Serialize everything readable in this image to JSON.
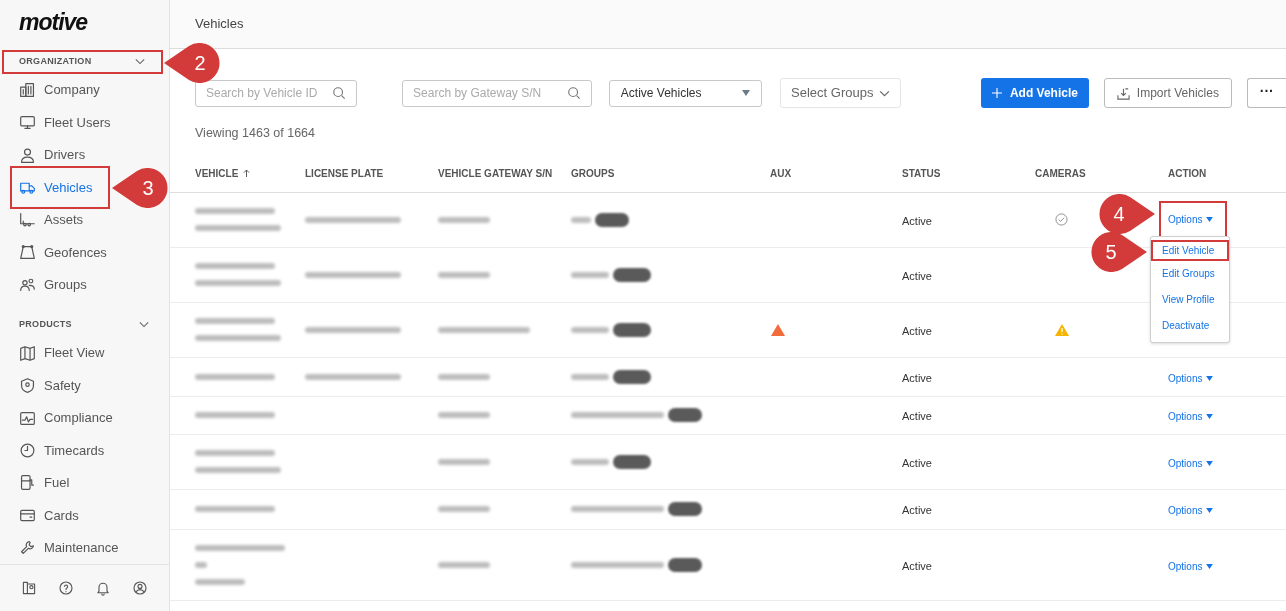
{
  "logo": "motive",
  "sidebar": {
    "sections": [
      {
        "title": "ORGANIZATION",
        "expanded": true,
        "items": [
          {
            "label": "Company",
            "selected": false
          },
          {
            "label": "Fleet Users",
            "selected": false
          },
          {
            "label": "Drivers",
            "selected": false
          },
          {
            "label": "Vehicles",
            "selected": true
          },
          {
            "label": "Assets",
            "selected": false
          },
          {
            "label": "Geofences",
            "selected": false
          },
          {
            "label": "Groups",
            "selected": false
          }
        ]
      },
      {
        "title": "PRODUCTS",
        "expanded": true,
        "items": [
          {
            "label": "Fleet View",
            "selected": false
          },
          {
            "label": "Safety",
            "selected": false
          },
          {
            "label": "Compliance",
            "selected": false
          },
          {
            "label": "Timecards",
            "selected": false
          },
          {
            "label": "Fuel",
            "selected": false
          },
          {
            "label": "Cards",
            "selected": false
          },
          {
            "label": "Maintenance",
            "selected": false
          }
        ]
      }
    ]
  },
  "page_title": "Vehicles",
  "toolbar": {
    "search_vehicle": {
      "placeholder": "Search by Vehicle ID"
    },
    "search_gateway": {
      "placeholder": "Search by Gateway S/N"
    },
    "status_select": "Active Vehicles",
    "groups_select": "Select Groups",
    "add_button": "Add Vehicle",
    "import_button": "Import Vehicles",
    "more_button": "···"
  },
  "viewing": "Viewing 1463 of 1664",
  "table": {
    "columns": [
      {
        "label": "VEHICLE",
        "sorted": true
      },
      {
        "label": "LICENSE PLATE",
        "sorted": false
      },
      {
        "label": "VEHICLE GATEWAY S/N",
        "sorted": false
      },
      {
        "label": "GROUPS",
        "sorted": false
      },
      {
        "label": "AUX",
        "sorted": false
      },
      {
        "label": "STATUS",
        "sorted": false
      },
      {
        "label": "CAMERAS",
        "sorted": false
      },
      {
        "label": "ACTION",
        "sorted": false
      }
    ],
    "rows": [
      {
        "aux_warning": false,
        "status": "Active",
        "camera_ok": true,
        "camera_warning": false,
        "action": "Options"
      },
      {
        "aux_warning": false,
        "status": "Active",
        "camera_ok": false,
        "camera_warning": false
      },
      {
        "aux_warning": true,
        "status": "Active",
        "camera_ok": false,
        "camera_warning": true
      },
      {
        "aux_warning": false,
        "status": "Active",
        "camera_ok": false,
        "camera_warning": false,
        "action": "Options"
      },
      {
        "aux_warning": false,
        "status": "Active",
        "camera_ok": false,
        "camera_warning": false,
        "action": "Options"
      },
      {
        "aux_warning": false,
        "status": "Active",
        "camera_ok": false,
        "camera_warning": false,
        "action": "Options"
      },
      {
        "aux_warning": false,
        "status": "Active",
        "camera_ok": false,
        "camera_warning": false,
        "action": "Options"
      },
      {
        "aux_warning": false,
        "status": "Active",
        "camera_ok": false,
        "camera_warning": false,
        "action": "Options"
      }
    ]
  },
  "options_menu": [
    "Edit Vehicle",
    "Edit Groups",
    "View Profile",
    "Deactivate"
  ],
  "annotations": [
    {
      "number": "2",
      "kind": "section"
    },
    {
      "number": "3",
      "kind": "nav"
    },
    {
      "number": "4",
      "kind": "options"
    },
    {
      "number": "5",
      "kind": "menu"
    }
  ]
}
